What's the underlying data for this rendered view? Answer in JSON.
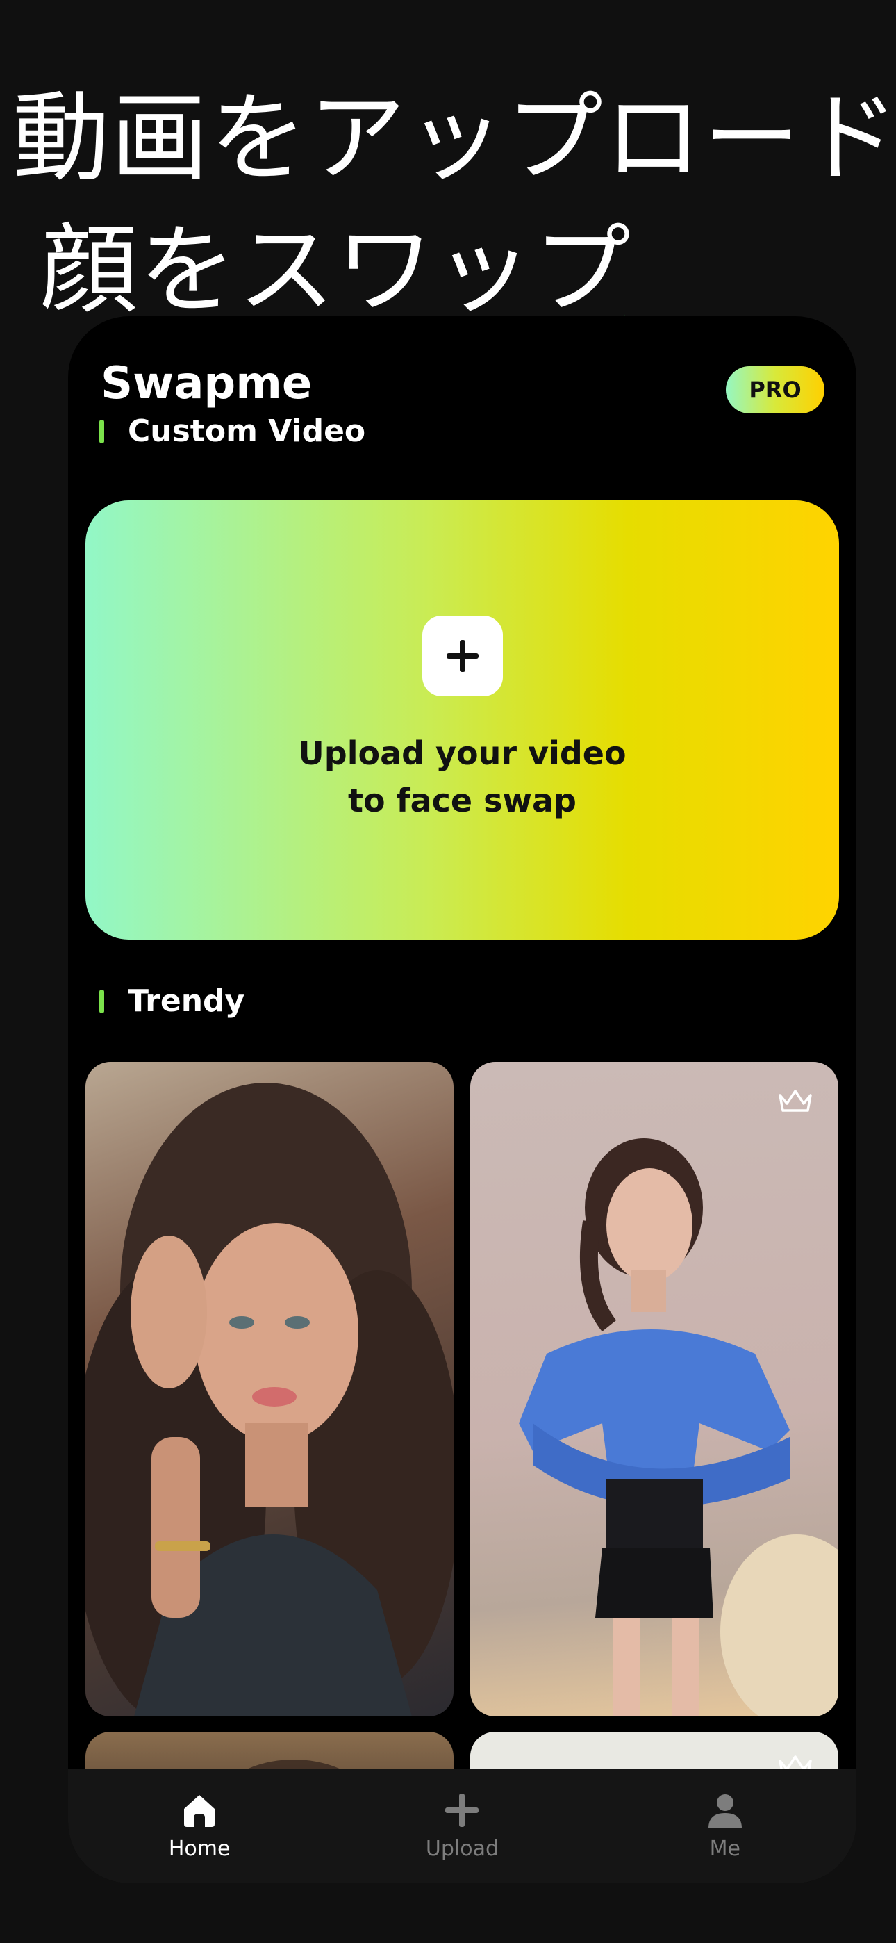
{
  "promo": {
    "line1": "動画をアップロード",
    "line2": "顔をスワップ"
  },
  "header": {
    "app_title": "Swapme",
    "pro_badge": "PRO"
  },
  "sections": {
    "custom": "Custom Video",
    "trendy": "Trendy"
  },
  "upload_card": {
    "line1": "Upload your video",
    "line2": "to face swap"
  },
  "trendy_items": [
    {
      "premium": false,
      "image": "woman-long-dark-hair-photo"
    },
    {
      "premium": true,
      "image": "woman-blue-off-shoulder-top-photo"
    },
    {
      "premium": false,
      "image": "partial-thumbnail"
    },
    {
      "premium": true,
      "image": "partial-thumbnail"
    }
  ],
  "tabbar": {
    "items": [
      {
        "label": "Home",
        "icon": "home-icon",
        "active": true
      },
      {
        "label": "Upload",
        "icon": "plus-icon",
        "active": false
      },
      {
        "label": "Me",
        "icon": "person-icon",
        "active": false
      }
    ]
  },
  "colors": {
    "accent_green": "#7be24b",
    "gradient_start": "#92f7c7",
    "gradient_end": "#ffd300",
    "background": "#000000"
  }
}
